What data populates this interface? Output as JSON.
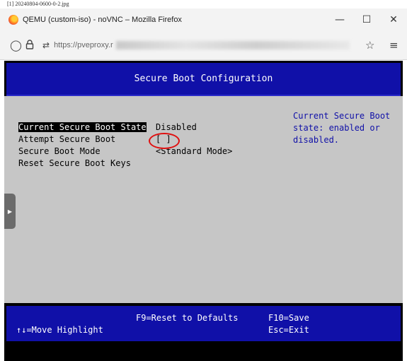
{
  "caption": "[1] 20240804-0600-0-2.jpg",
  "browser": {
    "window_title": "QEMU (custom-iso) - noVNC – Mozilla Firefox",
    "controls": {
      "minimize": "—",
      "maximize": "☐",
      "close": "✕"
    },
    "url_prefix": "https://pveproxy.r",
    "icons": {
      "shield": "◯",
      "lock": "🔒",
      "perm": "⇄",
      "star": "☆",
      "menu": "≡"
    }
  },
  "bios": {
    "title": "Secure Boot Configuration",
    "options": [
      {
        "label": "Current Secure Boot State",
        "value": "Disabled"
      },
      {
        "label": "Attempt Secure Boot",
        "value": "[ ]"
      },
      {
        "label": "Secure Boot Mode",
        "value": "<Standard Mode>"
      },
      {
        "label": "Reset Secure Boot Keys",
        "value": ""
      }
    ],
    "help_text": "Current Secure Boot\nstate: enabled or\ndisabled.",
    "footer": {
      "move_hint": "↑↓=Move Highlight",
      "reset_hint": "F9=Reset to Defaults",
      "save_hint": "F10=Save",
      "exit_hint": "Esc=Exit"
    }
  },
  "colors": {
    "bios_blue": "#1010a8",
    "bios_gray": "#c6c6c6",
    "annotation_red": "#e01010"
  }
}
